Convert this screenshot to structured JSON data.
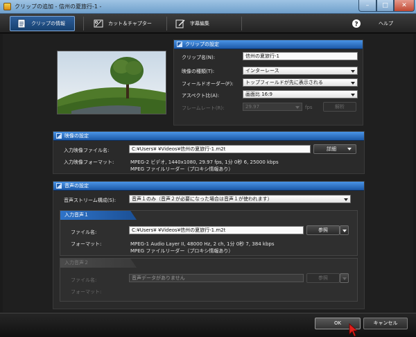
{
  "window": {
    "title": "クリップの追加 - 信州の夏旅行-1 -"
  },
  "toolbar": {
    "tabs": [
      {
        "label": "クリップの情報",
        "icon": "document-icon"
      },
      {
        "label": "カット＆チャプター",
        "icon": "cut-chapter-icon"
      },
      {
        "label": "字幕編集",
        "icon": "subtitle-edit-icon"
      },
      {
        "label": "ヘルプ",
        "icon": "help-icon"
      }
    ]
  },
  "clip": {
    "header": "クリップの設定",
    "name_label": "クリップ名(N):",
    "name_value": "信州の夏旅行-1",
    "video_type_label": "映像の種類(T):",
    "video_type_value": "インターレース",
    "field_order_label": "フィールドオーダー(F):",
    "field_order_value": "トップフィールドが先に表示される",
    "aspect_label": "アスペクト比(A):",
    "aspect_value": "画面比 16:9",
    "framerate_label": "フレームレート(R):",
    "framerate_value": "29.97",
    "framerate_unit": "fps",
    "analyze_button": "解析"
  },
  "video": {
    "header": "映像の設定",
    "input_file_label": "入力映像ファイル名:",
    "input_file_value": "C:¥Users¥                   ¥Videos¥信州の夏旅行-1.m2t",
    "details_button": "詳細",
    "format_label": "入力映像フォーマット:",
    "format_line1": "MPEG-2 ビデオ, 1440x1080, 29.97 fps, 1分 0秒 6, 25000 kbps",
    "format_line2": "MPEG ファイルリーダー（プロキシ情報あり）"
  },
  "audio": {
    "header": "音声の設定",
    "stream_label": "音声ストリーム構成(S):",
    "stream_value": "音声１のみ（音声２が必要になった場合は音声１が使われます）",
    "input1": {
      "header": "入力音声１",
      "file_label": "ファイル名:",
      "file_value": "C:¥Users¥                   ¥Videos¥信州の夏旅行-1.m2t",
      "browse_button": "参照",
      "format_label": "フォーマット:",
      "format_line1": "MPEG-1 Audio Layer II, 48000 Hz, 2 ch, 1分 0秒 7, 384 kbps",
      "format_line2": "MPEG ファイルリーダー（プロキシ情報あり）"
    },
    "input2": {
      "header": "入力音声２",
      "file_label": "ファイル名:",
      "file_value": "音声データがありません",
      "browse_button": "参照",
      "format_label": "フォーマット:"
    }
  },
  "buttons": {
    "ok": "OK",
    "cancel": "キャンセル"
  }
}
